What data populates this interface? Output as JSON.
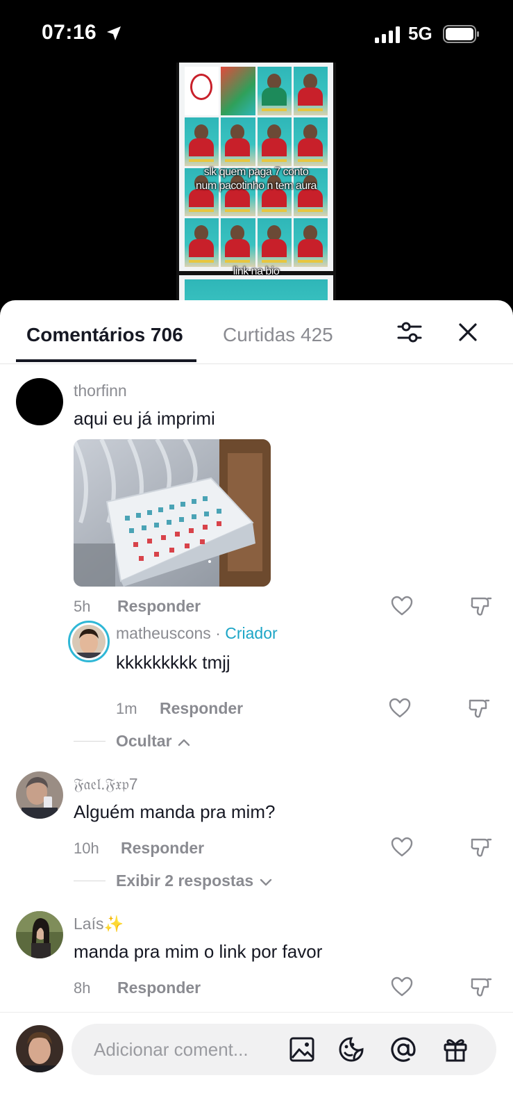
{
  "status_bar": {
    "time": "07:16",
    "network": "5G",
    "icons": [
      "location-arrow-icon",
      "signal-bars-icon",
      "battery-icon"
    ]
  },
  "video": {
    "caption": "slk quem paga 7 conto num pacotinho n tem aura",
    "caption_line1": "slk quem paga 7 conto",
    "caption_line2": "num pacotinho n tem aura",
    "bio_text": "link na bio"
  },
  "tabs": {
    "comments": "Comentários 706",
    "likes": "Curtidas 425"
  },
  "comments": [
    {
      "username": "thorfinn",
      "text": "aqui eu já imprimi",
      "time": "5h",
      "reply_label": "Responder",
      "has_image": true,
      "replies": [
        {
          "username": "matheuscons",
          "separator": " · ",
          "badge": "Criador",
          "text": "kkkkkkkkk tmjj",
          "time": "1m",
          "reply_label": "Responder"
        }
      ],
      "toggle_label": "Ocultar"
    },
    {
      "username": "𝔉𝔞𝔢𝔩.𝔉𝔵𝔭7",
      "text": "Alguém manda pra mim?",
      "time": "10h",
      "reply_label": "Responder",
      "toggle_label": "Exibir 2 respostas"
    },
    {
      "username": "Laís✨",
      "text": "manda pra mim o link por favor",
      "time": "8h",
      "reply_label": "Responder"
    }
  ],
  "composer": {
    "placeholder": "Adicionar coment...",
    "icons": [
      "image-icon",
      "sticker-icon",
      "mention-icon",
      "gift-icon"
    ]
  },
  "colors": {
    "creator_badge": "#1ca5c6",
    "text_primary": "#161823",
    "text_secondary": "#8a8b91"
  }
}
